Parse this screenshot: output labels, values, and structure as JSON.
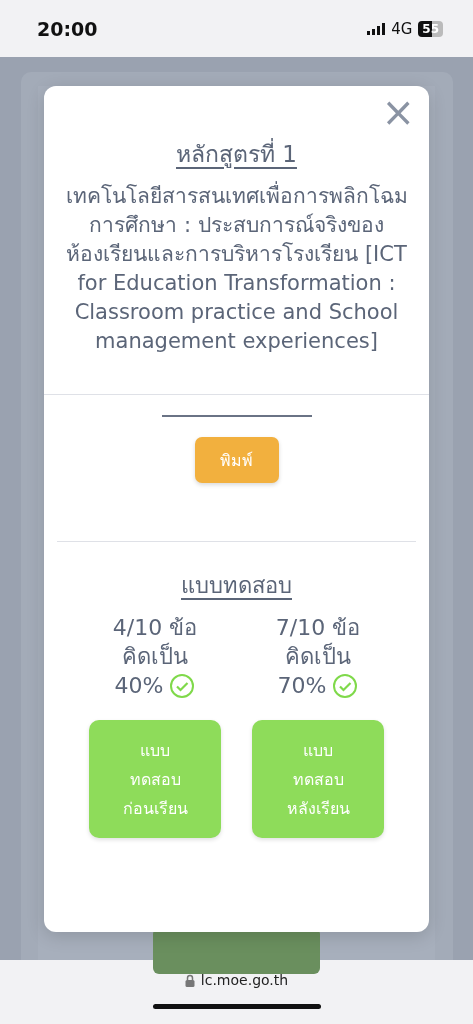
{
  "status_bar": {
    "time": "20:00",
    "network": "4G",
    "battery": "55"
  },
  "modal": {
    "close": "×",
    "title": "หลักสูตรที่ 1",
    "description": "เทคโนโลยีสารสนเทศเพื่อการพลิกโฉมการศึกษา : ประสบการณ์จริงของห้องเรียนและการบริหารโรงเรียน [ICT for Education Transformation : Classroom practice and School management experiences]",
    "print_button": "พิมพ์",
    "quiz_heading": "แบบทดสอบ",
    "quizzes": [
      {
        "score": "4/10 ข้อ",
        "label": "คิดเป็น",
        "percent": "40%",
        "passed": true,
        "button": "แบบทดสอบก่อนเรียน"
      },
      {
        "score": "7/10 ข้อ",
        "label": "คิดเป็น",
        "percent": "70%",
        "passed": true,
        "button": "แบบทดสอบหลังเรียน"
      }
    ]
  },
  "browser": {
    "url": "lc.moe.go.th"
  }
}
